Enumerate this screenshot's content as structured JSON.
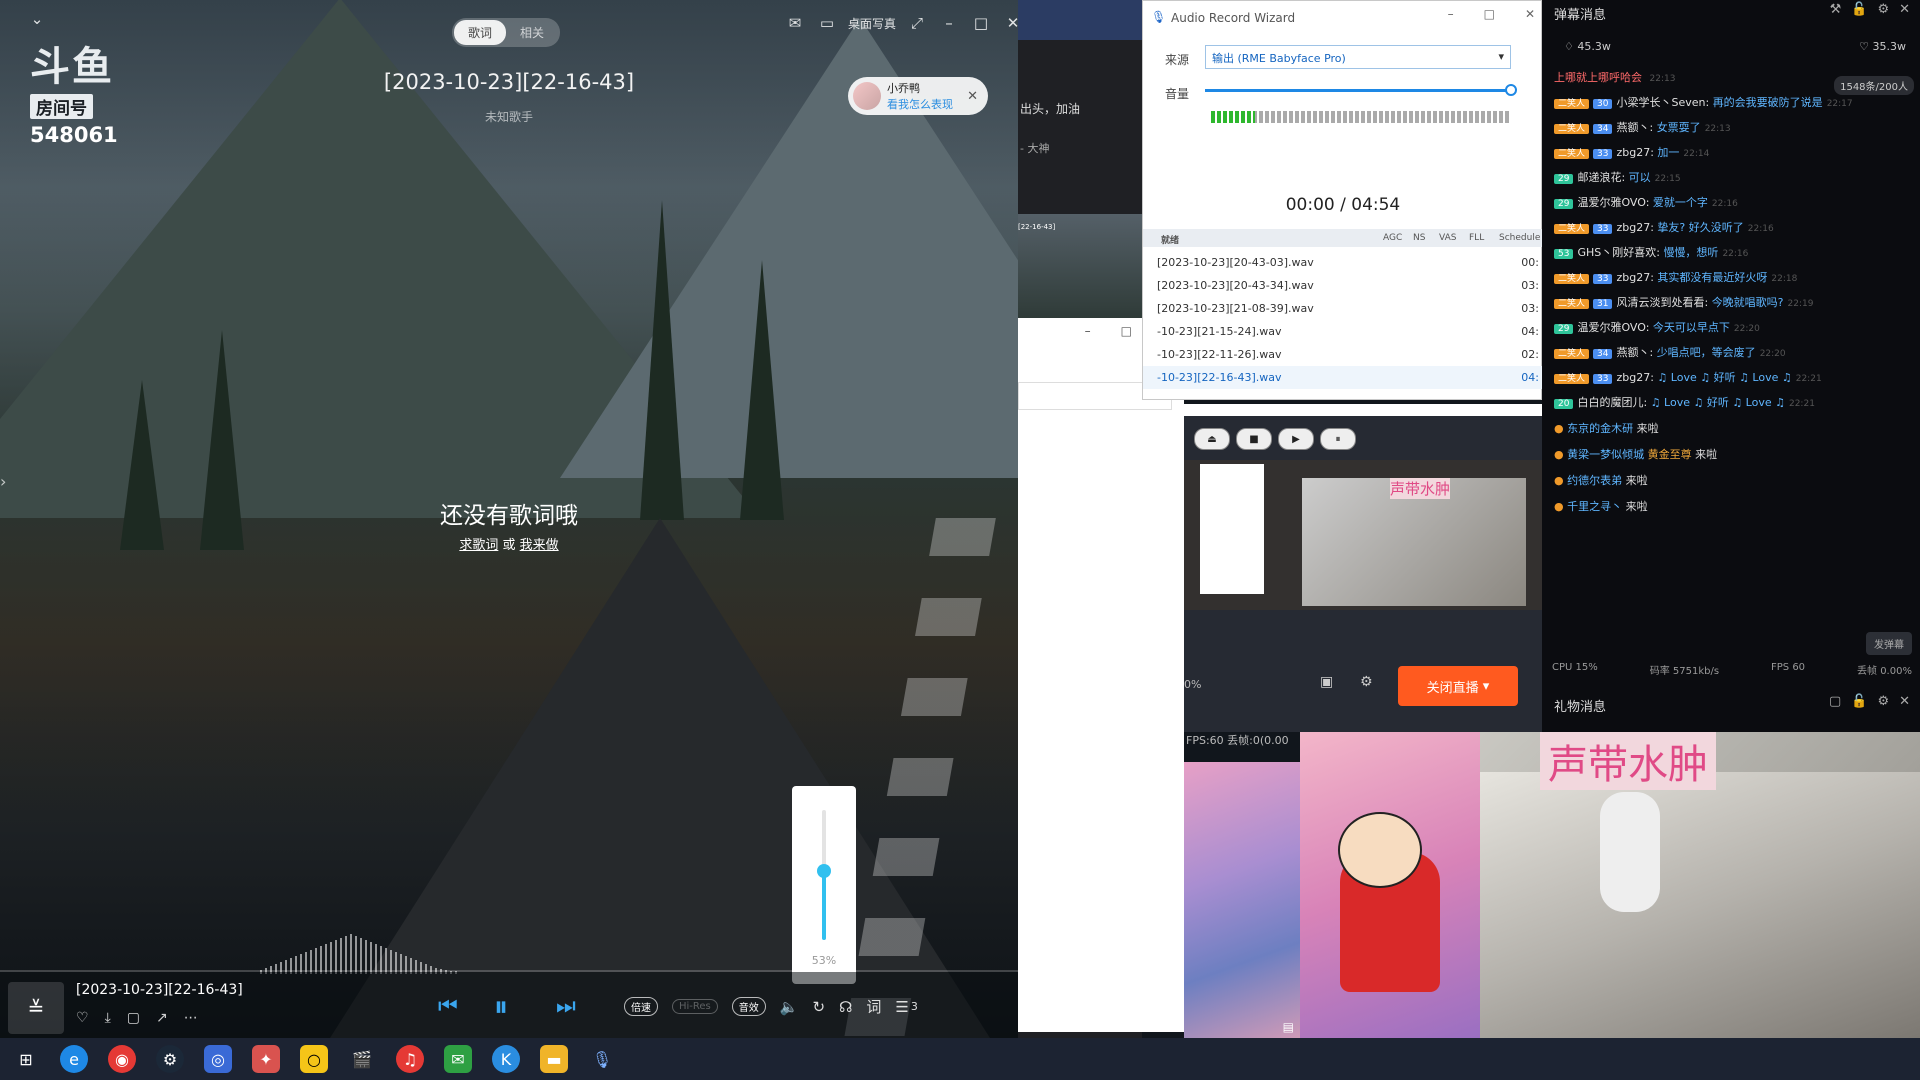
{
  "player": {
    "logo": {
      "brand": "斗鱼",
      "room_label": "房间号",
      "room_number": "548061"
    },
    "tabs": [
      {
        "label": "歌词",
        "active": true
      },
      {
        "label": "相关",
        "active": false
      }
    ],
    "top_right": {
      "mini_mode": "桌面写真"
    },
    "song_title": "[2023-10-23][22-16-43]",
    "artist": "未知歌手",
    "notify": {
      "name": "小乔鸭",
      "action": "看我怎么表现"
    },
    "no_lyrics": "还没有歌词哦",
    "lyric_hint": {
      "seek": "求歌词",
      "or": "或",
      "make": "我来做"
    },
    "volume": {
      "percent_text": "53%",
      "level": 0.53
    },
    "bottom": {
      "title": "[2023-10-23][22-16-43]",
      "speed_chip": "倍速",
      "hires_chip": "Hi-Res",
      "effect_chip": "音效",
      "lyric_btn": "词",
      "queue_count": "3"
    }
  },
  "arw": {
    "title": "Audio Record Wizard",
    "source_label": "来源",
    "source_value": "输出 (RME Babyface Pro)",
    "volume_label": "音量",
    "time": "00:00 / 04:54",
    "columns": {
      "tab": "就绪",
      "agc": "AGC",
      "ns": "NS",
      "vas": "VAS",
      "fll": "FLL",
      "schedule": "Schedule"
    },
    "files": [
      {
        "name": "[2023-10-23][20-43-03].wav",
        "dur": "00:"
      },
      {
        "name": "[2023-10-23][20-43-34].wav",
        "dur": "03:"
      },
      {
        "name": "[2023-10-23][21-08-39].wav",
        "dur": "03:"
      },
      {
        "name": "-10-23][21-15-24].wav",
        "dur": "04:"
      },
      {
        "name": "-10-23][22-11-26].wav",
        "dur": "02:"
      },
      {
        "name": "-10-23][22-16-43].wav",
        "dur": "04:"
      }
    ]
  },
  "mid": {
    "strip1": "出头，加油",
    "strip2": "- 大神",
    "mini_label": "[22-16-43]"
  },
  "obs": {
    "live_btn": "关闭直播",
    "percent": "0%",
    "fps": "FPS:60",
    "drop": "丢帧:0(0.00",
    "overlay": "声带水肿"
  },
  "chat": {
    "header": "弹幕消息",
    "likes": "45.3w",
    "hearts": "35.3w",
    "pinned": "上哪就上哪呼哈会",
    "pinned_time": "22:13",
    "count": "1548条/200人",
    "messages": [
      {
        "b1": "二笑人",
        "b2": "30",
        "name": "小梁学长丶Seven:",
        "text": "再的会我要破防了说是",
        "time": "22:17"
      },
      {
        "b1": "二笑人",
        "b2": "34",
        "name": "燕额丶:",
        "text": "女票耍了",
        "time": "22:13"
      },
      {
        "b1": "二笑人",
        "b2": "33",
        "name": "zbg27:",
        "text": "加一",
        "time": "22:14"
      },
      {
        "b1": "",
        "b2": "29",
        "name": "邮递浪花:",
        "text": "可以",
        "time": "22:15"
      },
      {
        "b1": "",
        "b2": "29",
        "name": "温爱尔雅OVO:",
        "text": "爱就一个字",
        "time": "22:16"
      },
      {
        "b1": "二笑人",
        "b2": "33",
        "name": "zbg27:",
        "text": "挚友? 好久没听了",
        "time": "22:16"
      },
      {
        "b1": "",
        "b2": "53",
        "name": "GHS丶刚好喜欢:",
        "text": "慢慢，想听",
        "time": "22:16"
      },
      {
        "b1": "二笑人",
        "b2": "33",
        "name": "zbg27:",
        "text": "其实都没有最近好火呀",
        "time": "22:18"
      },
      {
        "b1": "二笑人",
        "b2": "31",
        "name": "风清云淡到处看看:",
        "text": "今晚就唱歌吗?",
        "time": "22:19"
      },
      {
        "b1": "",
        "b2": "29",
        "name": "温爱尔雅OVO:",
        "text": "今天可以早点下",
        "time": "22:20"
      },
      {
        "b1": "二笑人",
        "b2": "34",
        "name": "燕额丶:",
        "text": "少唱点吧，等会废了",
        "time": "22:20"
      },
      {
        "b1": "二笑人",
        "b2": "33",
        "name": "zbg27:",
        "text": "♫ Love ♫ 好听 ♫ Love ♫",
        "time": "22:21"
      },
      {
        "b1": "",
        "b2": "20",
        "name": "白白的魔团儿:",
        "text": "♫ Love ♫ 好听 ♫ Love ♫",
        "time": "22:21"
      }
    ],
    "entries": [
      {
        "name": "东京的金木研",
        "suffix": "来啦"
      },
      {
        "name": "黄梁一梦似倾城",
        "extra": "黄金至尊",
        "suffix": "来啦"
      },
      {
        "name": "约德尔表弟",
        "suffix": "来啦"
      },
      {
        "name": "千里之寻丶",
        "suffix": "来啦"
      }
    ],
    "send": "发弹幕",
    "foot": {
      "cpu": "CPU 15%",
      "bitrate": "码率 5751kb/s",
      "fps": "FPS 60",
      "drop": "丢帧 0.00%"
    },
    "gift_header": "礼物消息"
  }
}
